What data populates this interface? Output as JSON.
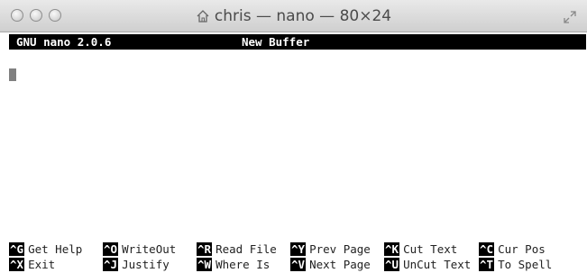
{
  "window": {
    "title": "chris — nano — 80×24"
  },
  "status_bar": {
    "program": "GNU nano 2.0.6",
    "buffer": "New Buffer"
  },
  "shortcuts": [
    {
      "key": "^G",
      "label": "Get Help"
    },
    {
      "key": "^O",
      "label": "WriteOut"
    },
    {
      "key": "^R",
      "label": "Read File"
    },
    {
      "key": "^Y",
      "label": "Prev Page"
    },
    {
      "key": "^K",
      "label": "Cut Text"
    },
    {
      "key": "^C",
      "label": "Cur Pos"
    },
    {
      "key": "^X",
      "label": "Exit"
    },
    {
      "key": "^J",
      "label": "Justify"
    },
    {
      "key": "^W",
      "label": "Where Is"
    },
    {
      "key": "^V",
      "label": "Next Page"
    },
    {
      "key": "^U",
      "label": "UnCut Text"
    },
    {
      "key": "^T",
      "label": "To Spell"
    }
  ]
}
